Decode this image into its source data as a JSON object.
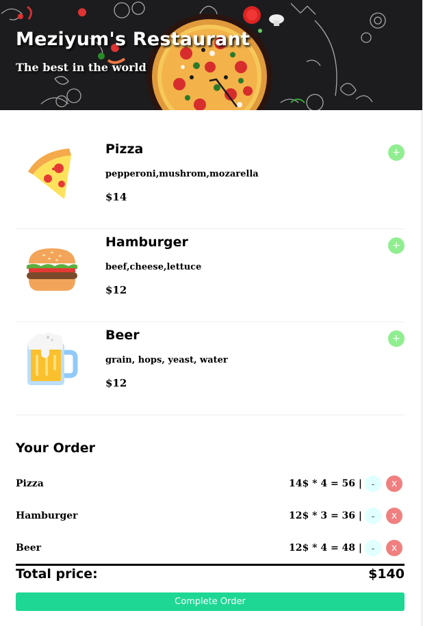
{
  "header": {
    "title": "Meziyum's Restaurant",
    "subtitle": "The best in the world"
  },
  "menu": {
    "add_label": "+",
    "items": [
      {
        "name": "Pizza",
        "description": "pepperoni,mushrom,mozarella",
        "price": "$14",
        "icon": "pizza-slice-icon"
      },
      {
        "name": "Hamburger",
        "description": "beef,cheese,lettuce",
        "price": "$12",
        "icon": "hamburger-icon"
      },
      {
        "name": "Beer",
        "description": "grain, hops, yeast, water",
        "price": "$12",
        "icon": "beer-mug-icon"
      }
    ]
  },
  "order": {
    "title": "Your Order",
    "decrease_label": "-",
    "remove_label": "x",
    "rows": [
      {
        "name": "Pizza",
        "calc": "14$ * 4 = 56 |"
      },
      {
        "name": "Hamburger",
        "calc": "12$ * 3 = 36 |"
      },
      {
        "name": "Beer",
        "calc": "12$ * 4 = 48 |"
      }
    ],
    "total_label": "Total price:",
    "total_value": "$140",
    "complete_label": "Complete Order"
  },
  "colors": {
    "add_button": "#90ee90",
    "decrease_button": "#e0ffff",
    "remove_button": "#f08080",
    "complete_button": "#1ed795",
    "header_background": "#1c1c1e"
  }
}
